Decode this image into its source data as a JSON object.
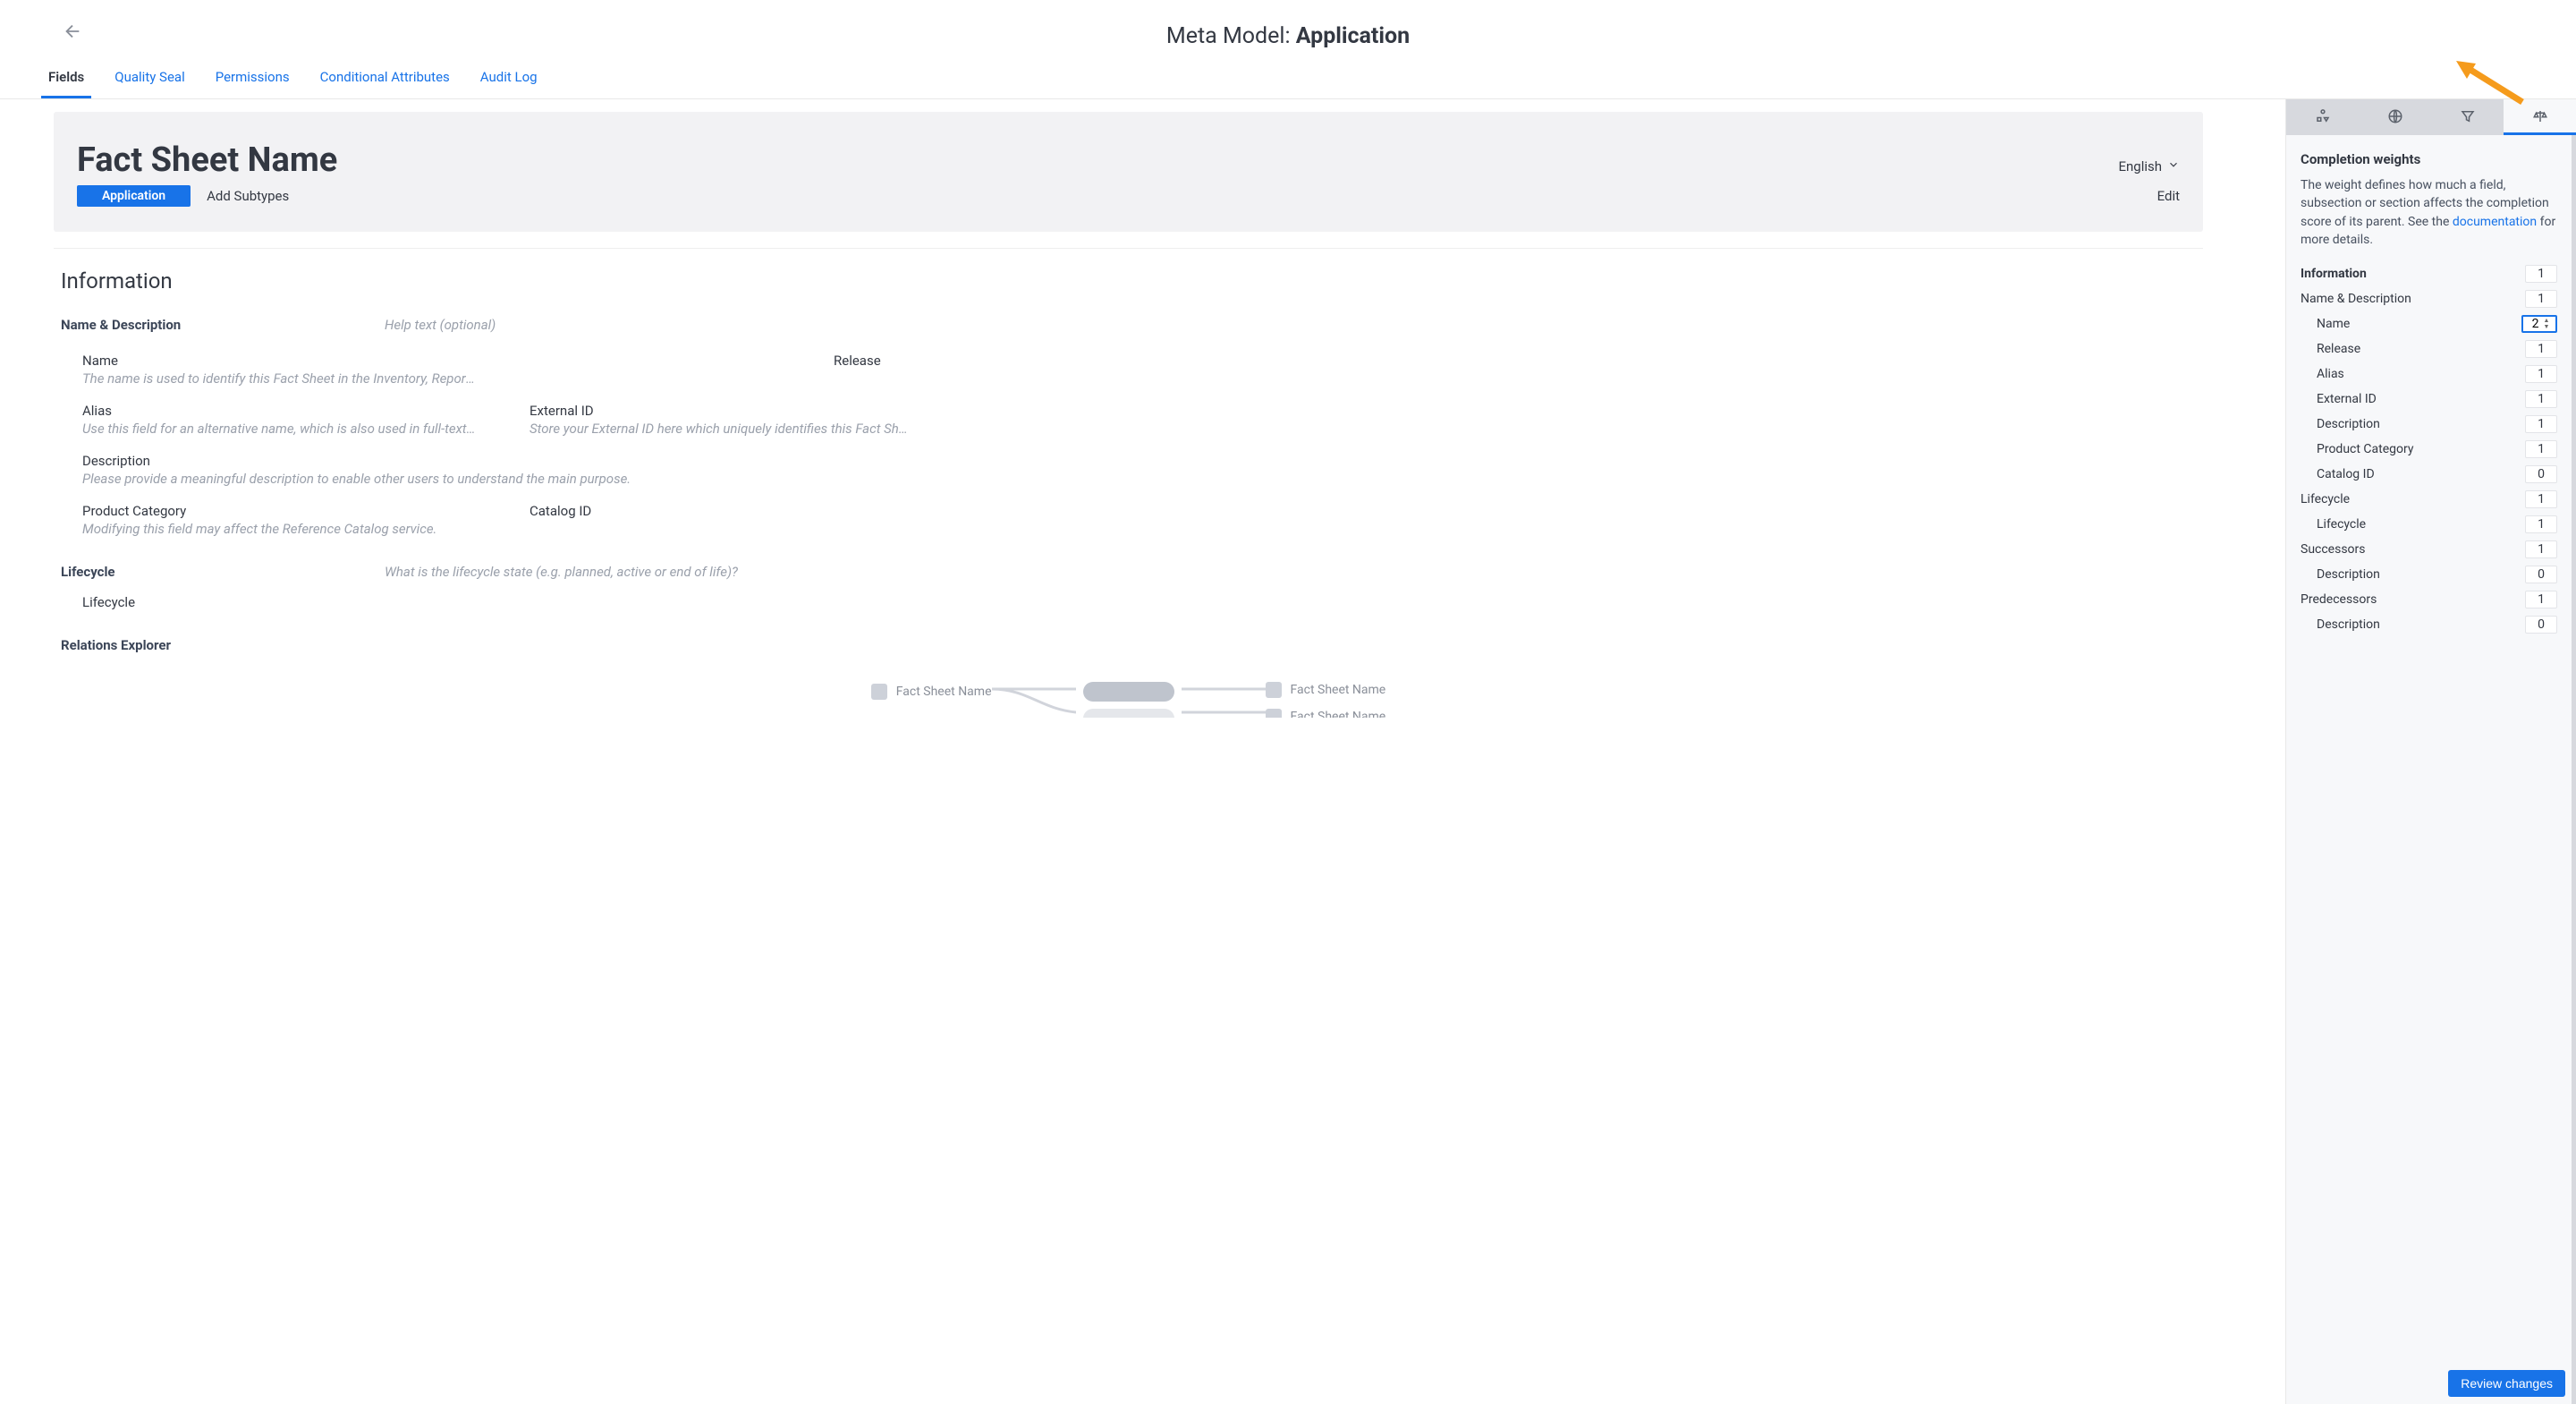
{
  "header": {
    "title_prefix": "Meta Model: ",
    "title_bold": "Application",
    "tabs": [
      "Fields",
      "Quality Seal",
      "Permissions",
      "Conditional Attributes",
      "Audit Log"
    ],
    "active_tab": 0
  },
  "hero": {
    "title": "Fact Sheet Name",
    "language": "English",
    "badge": "Application",
    "add_subtypes": "Add Subtypes",
    "edit": "Edit"
  },
  "information": {
    "heading": "Information",
    "name_desc": {
      "label": "Name & Description",
      "help": "Help text (optional)",
      "fields": [
        {
          "label": "Name",
          "help": "The name is used to identify this Fact Sheet in the Inventory, Reporting and Search.",
          "right": "Release"
        },
        {
          "label": "Alias",
          "help": "Use this field for an alternative name, which is also used in full-text sea…",
          "label2": "External ID",
          "help2": "Store your External ID here which uniquely identifies this Fact Sheet."
        },
        {
          "label": "Description",
          "help": "Please provide a meaningful description to enable other users to understand the main purpose."
        },
        {
          "label": "Product Category",
          "help": "Modifying this field may affect the Reference Catalog service.",
          "label2": "Catalog ID"
        }
      ]
    },
    "lifecycle": {
      "label": "Lifecycle",
      "help": "What is the lifecycle state (e.g. planned, active or end of life)?",
      "field": "Lifecycle"
    }
  },
  "relations": {
    "heading": "Relations Explorer",
    "item_text": "Fact Sheet Name"
  },
  "right_panel": {
    "title": "Completion weights",
    "desc_pre": "The weight defines how much a field, subsection or section affects the completion score of its parent. See the ",
    "desc_link": "documentation",
    "desc_post": " for more details.",
    "rows": [
      {
        "label": "Information",
        "value": "1",
        "level": "section"
      },
      {
        "label": "Name & Description",
        "value": "1",
        "level": "subsection"
      },
      {
        "label": "Name",
        "value": "2",
        "level": "field",
        "editing": true
      },
      {
        "label": "Release",
        "value": "1",
        "level": "field"
      },
      {
        "label": "Alias",
        "value": "1",
        "level": "field"
      },
      {
        "label": "External ID",
        "value": "1",
        "level": "field"
      },
      {
        "label": "Description",
        "value": "1",
        "level": "field"
      },
      {
        "label": "Product Category",
        "value": "1",
        "level": "field"
      },
      {
        "label": "Catalog ID",
        "value": "0",
        "level": "field"
      },
      {
        "label": "Lifecycle",
        "value": "1",
        "level": "subsection"
      },
      {
        "label": "Lifecycle",
        "value": "1",
        "level": "field"
      },
      {
        "label": "Successors",
        "value": "1",
        "level": "subsection"
      },
      {
        "label": "Description",
        "value": "0",
        "level": "field"
      },
      {
        "label": "Predecessors",
        "value": "1",
        "level": "subsection"
      },
      {
        "label": "Description",
        "value": "0",
        "level": "field"
      }
    ],
    "review_btn": "Review changes"
  }
}
